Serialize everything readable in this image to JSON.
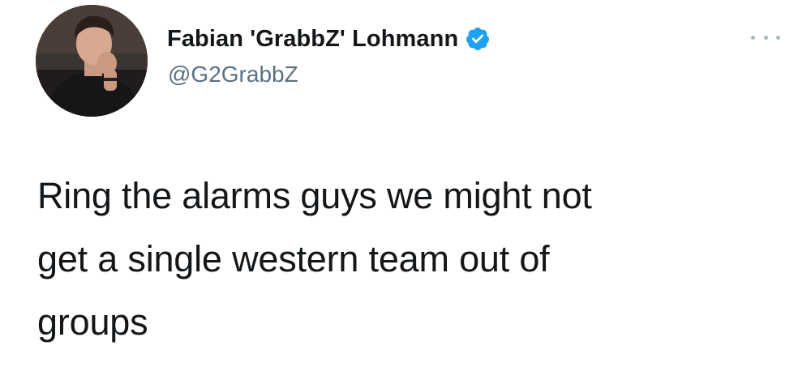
{
  "author": {
    "display_name": "Fabian 'GrabbZ' Lohmann",
    "handle": "@G2GrabbZ",
    "verified": true,
    "avatar_icon": "profile-photo",
    "verified_icon": "verified-badge-icon",
    "verified_color": "#1da1f2"
  },
  "menu": {
    "icon": "more-options-icon"
  },
  "tweet": {
    "lines": [
      "Ring the alarms guys we might not",
      "get a single western team out of",
      "groups"
    ]
  },
  "colors": {
    "text": "#14171a",
    "secondary_text": "#5b7083",
    "background": "#ffffff"
  }
}
